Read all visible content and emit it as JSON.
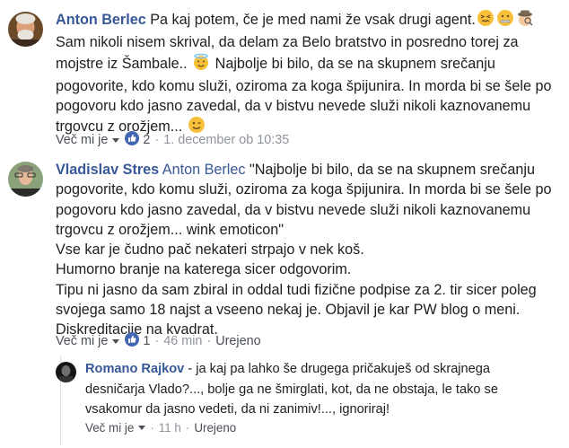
{
  "comments": [
    {
      "author": "Anton Berlec",
      "line1": " Pa kaj potem, če je med nami že vsak drugi agent.",
      "line2": "Sam nikoli nisem skrival, da delam za Belo bratstvo in posredno torej za",
      "line3a": "mojstre iz Šambale.. ",
      "line3b": " Najbolje bi bilo, da se na skupnem srečanju",
      "line4": "pogovorite, kdo komu služi, oziroma za koga špijunira. In morda bi se šele po",
      "line5": "pogovoru kdo jasno zavedal, da v bistvu nevede služi nikoli kaznovanemu",
      "line6": "trgovcu z orožjem... ",
      "like_label": "Več mi je",
      "like_count": "2",
      "sep": "·",
      "timestamp": "1. december ob 10:35",
      "emoji_names": [
        "confounded-face-icon",
        "zipper-mouth-face-icon",
        "detective-icon",
        "smiling-face-with-halo-icon",
        "winking-face-icon"
      ]
    },
    {
      "author": "Vladislav Stres",
      "mention": "Anton Berlec",
      "line1": " \"Najbolje bi bilo, da se na skupnem srečanju",
      "line2": "pogovorite, kdo komu služi, oziroma za koga špijunira. In morda bi se šele po",
      "line3": "pogovoru kdo jasno zavedal, da v bistvu nevede služi nikoli kaznovanemu",
      "line4": "trgovcu z orožjem... wink emoticon\"",
      "line5": "Vse kar je čudno pač nekateri strpajo v nek koš.",
      "line6": "Humorno branje na katerega sicer odgovorim.",
      "line7": "Tipu ni jasno da sam zbiral in oddal tudi fizične podpise za 2. tir sicer poleg",
      "line8": "svojega samo 18 najst a vseeno nekaj je. Objavil je kar PW blog o meni.",
      "line9": "Diskreditacije na kvadrat.",
      "like_label": "Več mi je",
      "like_count": "1",
      "sep": "·",
      "timestamp": "46 min",
      "edited": "Urejeno"
    },
    {
      "author": "Romano Rajkov",
      "line1": " - ja kaj pa lahko še drugega pričakuješ od skrajnega",
      "line2": "desničarja Vlado?..., bolje ga ne šmirglati, kot, da ne obstaja, le tako se",
      "line3": "vsakomur da jasno vedeti, da ni zanimiv!..., ignoriraj!",
      "like_label": "Več mi je",
      "sep": "·",
      "timestamp": "11 h",
      "edited": "Urejeno"
    }
  ],
  "colors": {
    "link": "#385898",
    "text": "#1c1e21",
    "meta": "#90949c",
    "like_blue": "#4267b2"
  }
}
